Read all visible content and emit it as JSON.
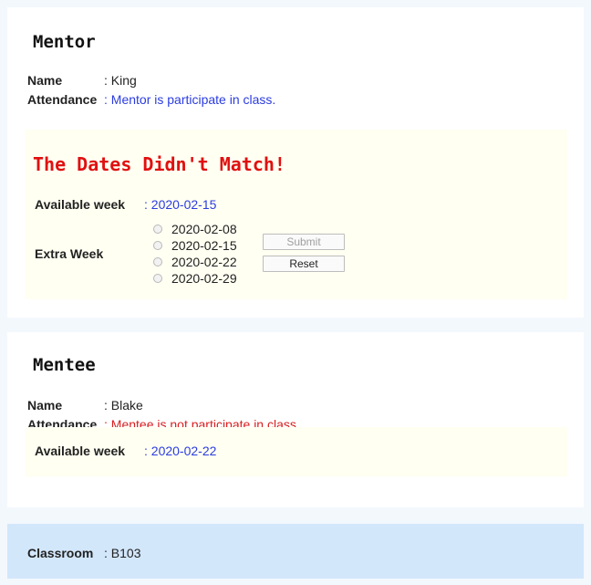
{
  "mentor": {
    "heading": "Mentor",
    "name_label": "Name",
    "name_value": ": King",
    "attendance_label": "Attendance",
    "attendance_value": ": Mentor is participate in class.",
    "mismatch": {
      "title": "The Dates Didn't Match!",
      "available_label": "Available week",
      "available_value": ": 2020-02-15",
      "extra_label": "Extra Week",
      "options": [
        "2020-02-08",
        "2020-02-15",
        "2020-02-22",
        "2020-02-29"
      ],
      "submit_label": "Submit",
      "reset_label": "Reset"
    }
  },
  "mentee": {
    "heading": "Mentee",
    "name_label": "Name",
    "name_value": ": Blake",
    "attendance_label": "Attendance",
    "attendance_value": ": Mentee is not participate in class.",
    "available_label": "Available week",
    "available_value": ": 2020-02-22"
  },
  "classroom": {
    "label": "Classroom",
    "value": ": B103"
  },
  "colors": {
    "accent_blue": "#2b3ce0",
    "alert_red": "#e01010",
    "classroom_bg": "#d3e7fb",
    "box_bg": "#fffff2"
  }
}
